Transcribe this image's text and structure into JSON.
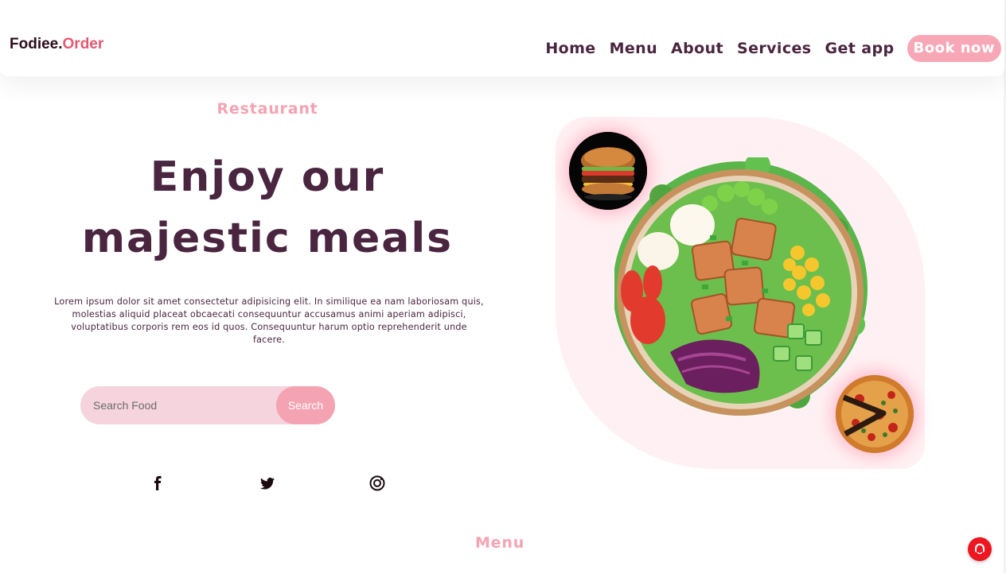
{
  "header": {
    "logo_main": "Fodiee.",
    "logo_accent": "Order",
    "nav": [
      "Home",
      "Menu",
      "About",
      "Services",
      "Get app"
    ],
    "cta_label": "Book now"
  },
  "hero": {
    "tag": "Restaurant",
    "title_line1": "Enjoy our",
    "title_line2": "majestic meals",
    "description": "Lorem ipsum dolor sit amet consectetur adipisicing elit. In similique ea nam laboriosam quis, molestias aliquid placeat obcaecati consequuntur accusamus animi aperiam adipisci, voluptatibus corporis rem eos id quos. Consequuntur harum optio reprehenderit unde facere.",
    "search": {
      "placeholder": "Search Food",
      "button_label": "Search"
    }
  },
  "social": [
    "facebook-icon",
    "twitter-icon",
    "instagram-icon"
  ],
  "menu_section": {
    "title": "Menu"
  },
  "colors": {
    "brand_dark": "#4a2540",
    "accent_pink": "#f7a7b6",
    "logo_accent": "#e45a72",
    "hero_bg": "#fff0f3",
    "fab_red": "#ee1620"
  }
}
